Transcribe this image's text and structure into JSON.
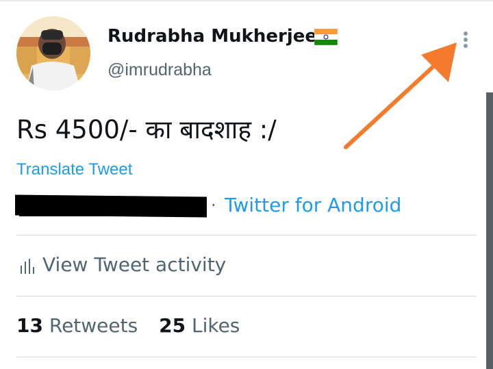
{
  "profile": {
    "display_name": "Rudrabha Mukherjee",
    "handle": "@imrudrabha",
    "flag_icon": "india-flag-icon"
  },
  "more_icon": "vertical-ellipsis-icon",
  "tweet": {
    "text": "Rs 4500/- का बादशाह :/",
    "translate_label": "Translate Tweet",
    "meta_separator": "·",
    "source": "Twitter for Android"
  },
  "activity": {
    "icon": "analytics-bars-icon",
    "label": "View Tweet activity"
  },
  "stats": {
    "retweets_count": "13",
    "retweets_label": "Retweets",
    "likes_count": "25",
    "likes_label": "Likes"
  },
  "colors": {
    "link": "#1d9bf0",
    "secondary_text": "#536471",
    "primary_text": "#0f1419",
    "annotation_arrow": "#f47a2c"
  }
}
